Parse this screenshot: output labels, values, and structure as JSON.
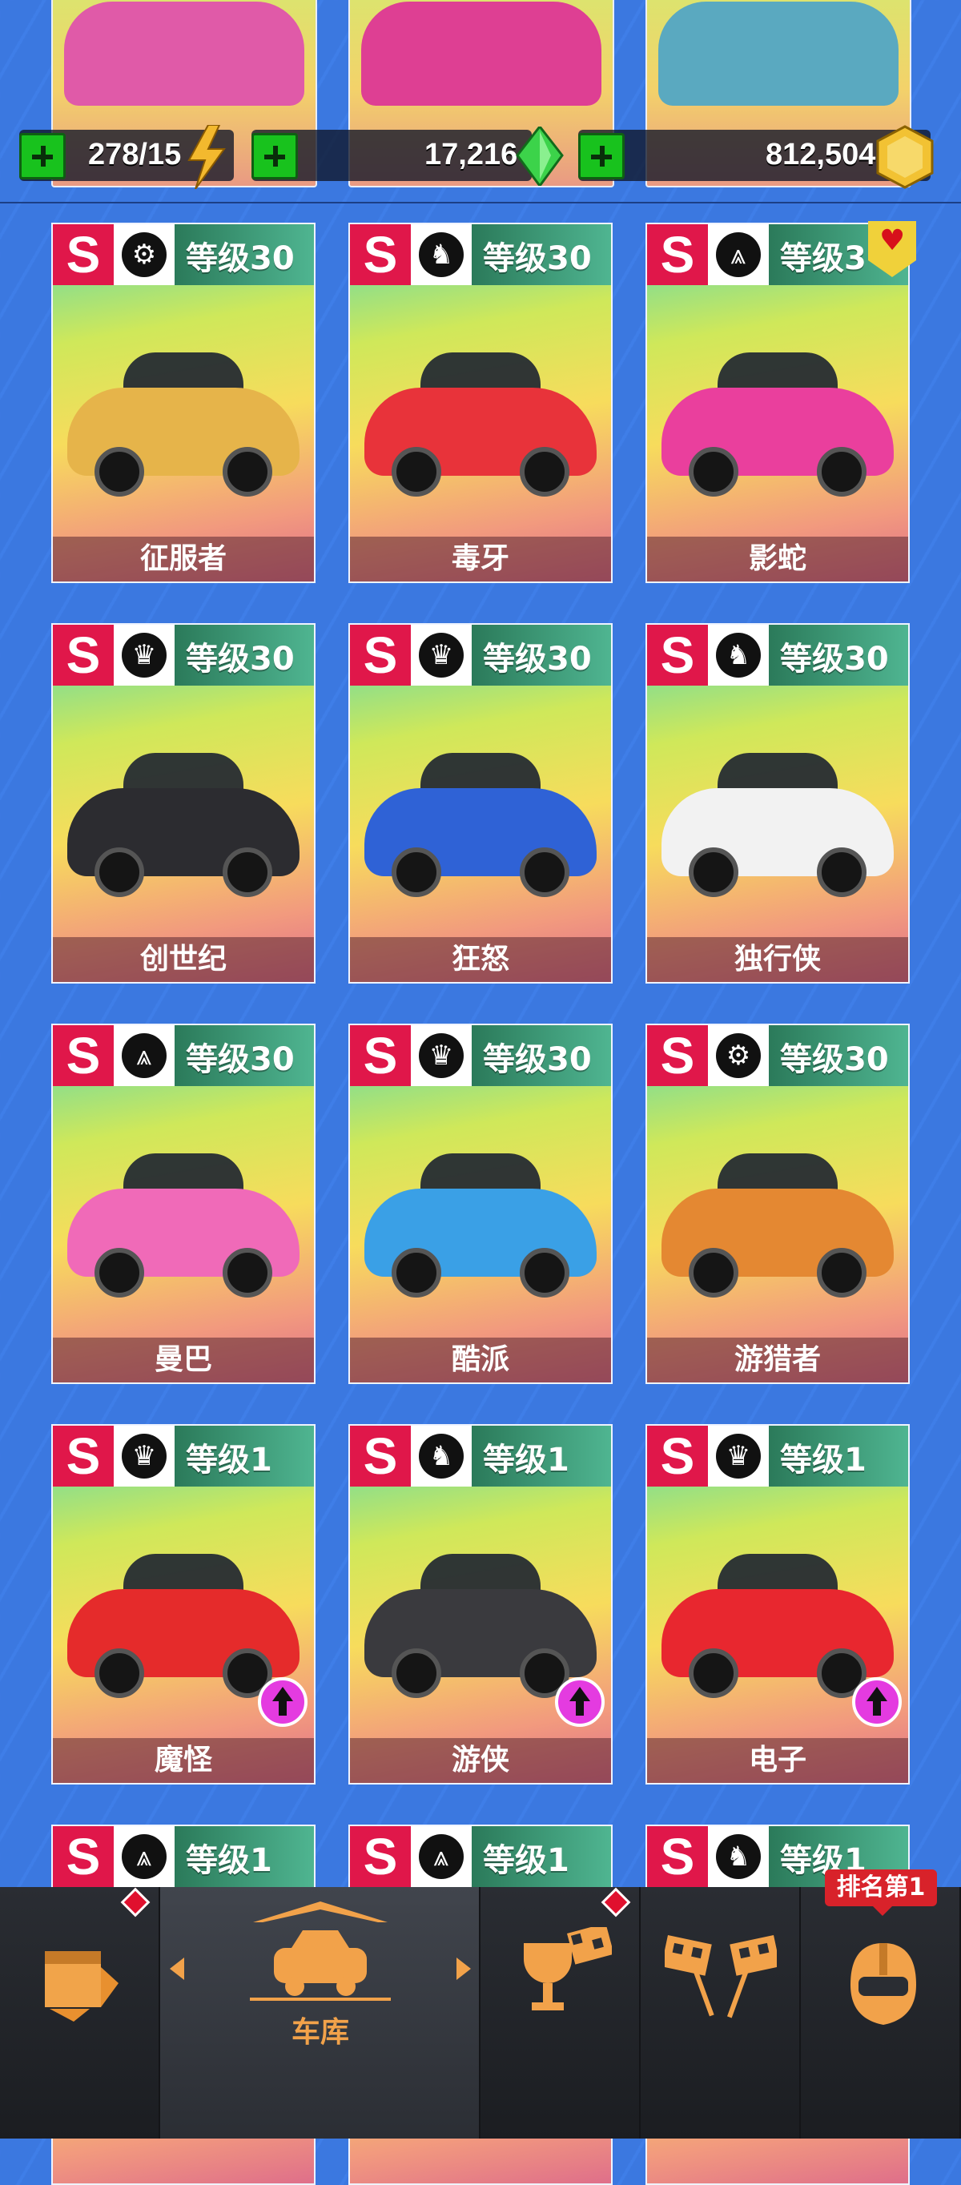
{
  "resources": {
    "energy": "278/15",
    "gems": "17,216",
    "coins": "812,504"
  },
  "cars": [
    {
      "cls": "S",
      "class_icon": "wheel-icon",
      "level": "等级30",
      "name": "征服者",
      "color": "#e6b44a",
      "fav": false,
      "upgrade": false
    },
    {
      "cls": "S",
      "class_icon": "horse-icon",
      "level": "等级30",
      "name": "毒牙",
      "color": "#e8333a",
      "fav": false,
      "upgrade": false
    },
    {
      "cls": "S",
      "class_icon": "road-icon",
      "level": "等级3",
      "name": "影蛇",
      "color": "#ea3f9d",
      "fav": true,
      "upgrade": false
    },
    {
      "cls": "S",
      "class_icon": "crown-icon",
      "level": "等级30",
      "name": "创世纪",
      "color": "#2c2c30",
      "fav": false,
      "upgrade": false
    },
    {
      "cls": "S",
      "class_icon": "crown-icon",
      "level": "等级30",
      "name": "狂怒",
      "color": "#2f62d6",
      "fav": false,
      "upgrade": false
    },
    {
      "cls": "S",
      "class_icon": "horse-icon",
      "level": "等级30",
      "name": "独行侠",
      "color": "#f2f2f2",
      "fav": false,
      "upgrade": false
    },
    {
      "cls": "S",
      "class_icon": "road-icon",
      "level": "等级30",
      "name": "曼巴",
      "color": "#f06ab8",
      "fav": false,
      "upgrade": false
    },
    {
      "cls": "S",
      "class_icon": "crown-icon",
      "level": "等级30",
      "name": "酷派",
      "color": "#3aa0e6",
      "fav": false,
      "upgrade": false
    },
    {
      "cls": "S",
      "class_icon": "wheel-icon",
      "level": "等级30",
      "name": "游猎者",
      "color": "#e48832",
      "fav": false,
      "upgrade": false
    },
    {
      "cls": "S",
      "class_icon": "crown-icon",
      "level": "等级1",
      "name": "魔怪",
      "color": "#e52b2b",
      "fav": false,
      "upgrade": true
    },
    {
      "cls": "S",
      "class_icon": "horse-icon",
      "level": "等级1",
      "name": "游侠",
      "color": "#3a3a3e",
      "fav": false,
      "upgrade": true
    },
    {
      "cls": "S",
      "class_icon": "crown-icon",
      "level": "等级1",
      "name": "电子",
      "color": "#e8272f",
      "fav": false,
      "upgrade": true
    },
    {
      "cls": "S",
      "class_icon": "road-icon",
      "level": "等级1",
      "name": "",
      "color": "#777",
      "fav": false,
      "upgrade": false
    },
    {
      "cls": "S",
      "class_icon": "road-icon",
      "level": "等级1",
      "name": "",
      "color": "#777",
      "fav": false,
      "upgrade": false
    },
    {
      "cls": "S",
      "class_icon": "horse-icon",
      "level": "等级1",
      "name": "",
      "color": "#777",
      "fav": false,
      "upgrade": false
    }
  ],
  "top_cars": [
    {
      "color": "#e05aa8"
    },
    {
      "color": "#de3f93"
    },
    {
      "color": "#5aa9c0"
    }
  ],
  "nav": {
    "garage_label": "车库",
    "rank_label": "排名第1"
  }
}
